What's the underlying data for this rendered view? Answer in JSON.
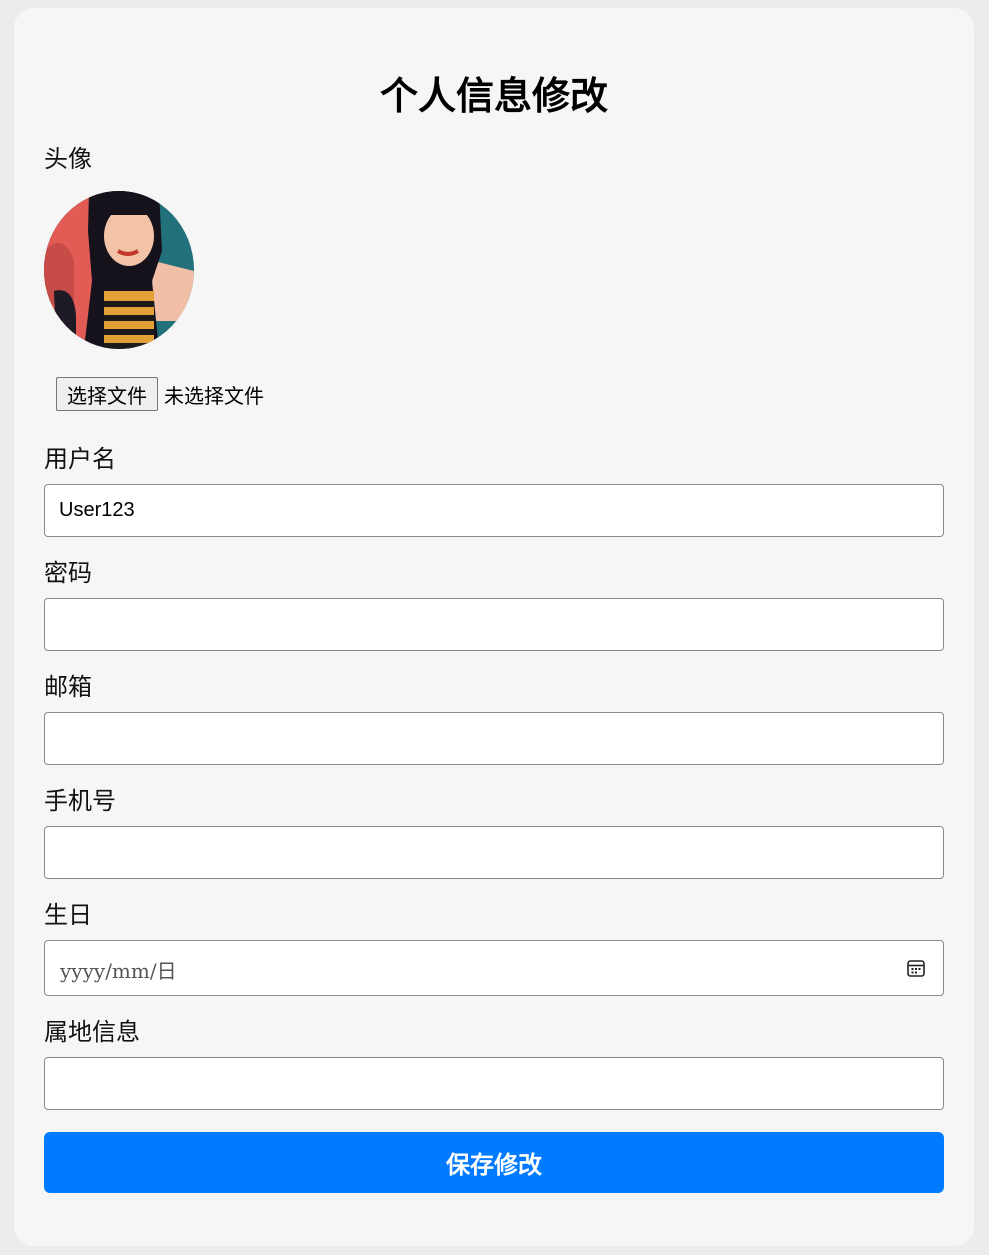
{
  "page": {
    "title": "个人信息修改"
  },
  "avatar": {
    "label": "头像",
    "choose_file_label": "选择文件",
    "file_status": "未选择文件"
  },
  "fields": {
    "username": {
      "label": "用户名",
      "value": "User123"
    },
    "password": {
      "label": "密码",
      "value": ""
    },
    "email": {
      "label": "邮箱",
      "value": ""
    },
    "phone": {
      "label": "手机号",
      "value": ""
    },
    "birthday": {
      "label": "生日",
      "placeholder": "yyyy/mm/日"
    },
    "location": {
      "label": "属地信息",
      "value": ""
    }
  },
  "actions": {
    "save_label": "保存修改"
  },
  "colors": {
    "primary": "#007bff",
    "card_background": "#f6f6f6",
    "page_background": "#ececec"
  },
  "icons": {
    "date_picker": "calendar-icon"
  }
}
